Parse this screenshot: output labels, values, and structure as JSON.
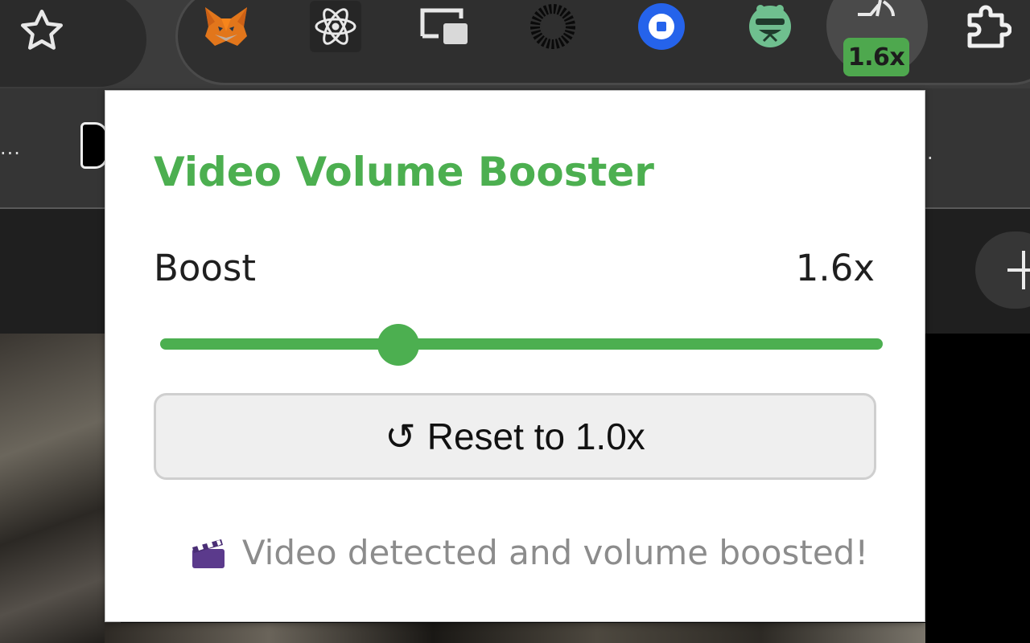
{
  "browser": {
    "bookmark_star": "star-icon",
    "extensions": [
      {
        "name": "metamask-fox-icon"
      },
      {
        "name": "react-devtools-icon"
      },
      {
        "name": "picture-in-picture-icon"
      },
      {
        "name": "loading-ring-icon"
      },
      {
        "name": "blue-circle-extension-icon"
      },
      {
        "name": "green-monster-extension-icon"
      },
      {
        "name": "volume-booster-extension-icon",
        "badge": "1.6x"
      },
      {
        "name": "puzzle-piece-extensions-icon"
      }
    ],
    "bookmarks_overflow": "...",
    "bookmarks_overflow_right": "."
  },
  "popup": {
    "title": "Video Volume Booster",
    "boost_label": "Boost",
    "boost_value": "1.6x",
    "slider": {
      "min": 1.0,
      "max": 5.0,
      "value": 1.6,
      "fraction": 0.33
    },
    "reset_glyph": "↺",
    "reset_label": "Reset to 1.0x",
    "status_text": "Video detected and volume boosted!",
    "status_icon": "clapperboard-icon"
  },
  "colors": {
    "accent": "#4caf50",
    "badge": "#4ea84e",
    "status_text": "#8c8c8c"
  }
}
